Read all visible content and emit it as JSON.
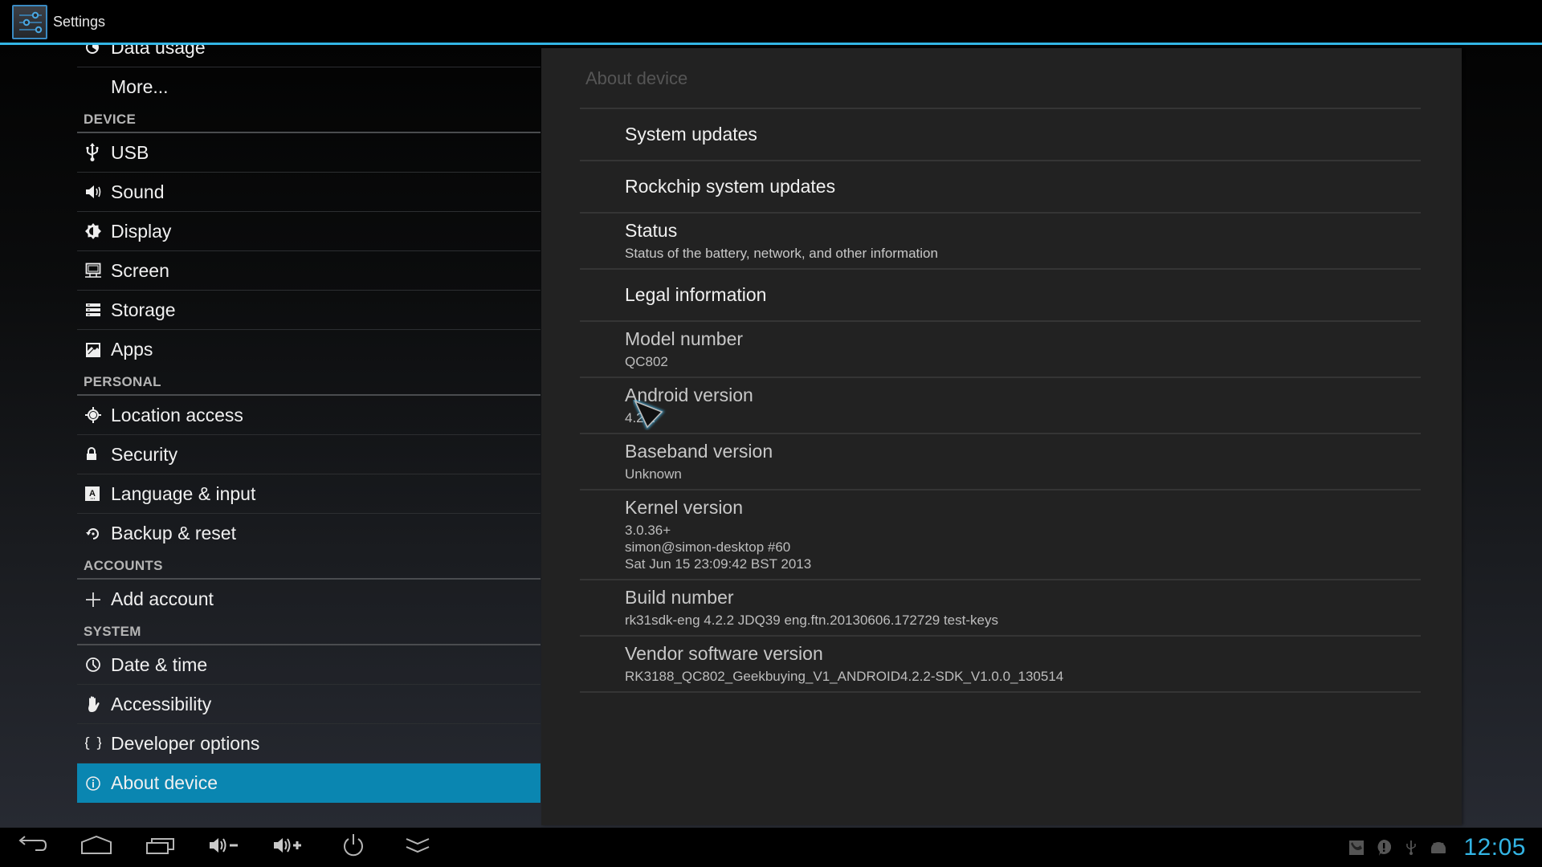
{
  "app": {
    "title": "Settings",
    "icon": "settings-sliders-icon",
    "accent_color": "#33b5e5",
    "selected_color": "#0a86b1"
  },
  "sidebar": {
    "groups": [
      {
        "header": null,
        "items": [
          {
            "label": "Data usage",
            "icon": "data-usage-icon"
          },
          {
            "label": "More...",
            "icon": null
          }
        ]
      },
      {
        "header": "DEVICE",
        "items": [
          {
            "label": "USB",
            "icon": "usb-icon"
          },
          {
            "label": "Sound",
            "icon": "sound-icon"
          },
          {
            "label": "Display",
            "icon": "display-brightness-icon"
          },
          {
            "label": "Screen",
            "icon": "screen-monitor-icon"
          },
          {
            "label": "Storage",
            "icon": "storage-icon"
          },
          {
            "label": "Apps",
            "icon": "apps-icon"
          }
        ]
      },
      {
        "header": "PERSONAL",
        "items": [
          {
            "label": "Location access",
            "icon": "location-icon"
          },
          {
            "label": "Security",
            "icon": "lock-icon"
          },
          {
            "label": "Language & input",
            "icon": "language-keyboard-icon"
          },
          {
            "label": "Backup & reset",
            "icon": "backup-reset-icon"
          }
        ]
      },
      {
        "header": "ACCOUNTS",
        "items": [
          {
            "label": "Add account",
            "icon": "plus-icon"
          }
        ]
      },
      {
        "header": "SYSTEM",
        "items": [
          {
            "label": "Date & time",
            "icon": "clock-icon"
          },
          {
            "label": "Accessibility",
            "icon": "hand-icon"
          },
          {
            "label": "Developer options",
            "icon": "braces-icon"
          },
          {
            "label": "About device",
            "icon": "info-icon",
            "selected": true
          }
        ]
      }
    ]
  },
  "panel": {
    "title": "About device",
    "items": [
      {
        "title": "System updates",
        "summary": null,
        "type": "action"
      },
      {
        "title": "Rockchip system updates",
        "summary": null,
        "type": "action"
      },
      {
        "title": "Status",
        "summary": "Status of the battery, network, and other information",
        "type": "action"
      },
      {
        "title": "Legal information",
        "summary": null,
        "type": "action"
      },
      {
        "title": "Model number",
        "summary": "QC802",
        "type": "info"
      },
      {
        "title": "Android version",
        "summary": "4.2.2",
        "type": "info"
      },
      {
        "title": "Baseband version",
        "summary": "Unknown",
        "type": "info"
      },
      {
        "title": "Kernel version",
        "summary_lines": [
          "3.0.36+",
          "simon@simon-desktop #60",
          "Sat Jun 15 23:09:42 BST 2013"
        ],
        "type": "info"
      },
      {
        "title": "Build number",
        "summary": "rk31sdk-eng 4.2.2 JDQ39 eng.ftn.20130606.172729 test-keys",
        "type": "info"
      },
      {
        "title": "Vendor software version",
        "summary": "RK3188_QC802_Geekbuying_V1_ANDROID4.2.2-SDK_V1.0.0_130514",
        "type": "info"
      }
    ]
  },
  "navbar": {
    "buttons": [
      {
        "name": "back",
        "icon": "back-icon"
      },
      {
        "name": "home",
        "icon": "home-icon"
      },
      {
        "name": "recents",
        "icon": "recent-apps-icon"
      },
      {
        "name": "volume-down",
        "icon": "volume-down-icon"
      },
      {
        "name": "volume-up",
        "icon": "volume-up-icon"
      },
      {
        "name": "power",
        "icon": "power-icon"
      },
      {
        "name": "expand",
        "icon": "chevron-double-down-icon"
      }
    ],
    "status_icons": [
      "screenshot-icon",
      "alert-icon",
      "usb-icon",
      "android-debug-icon"
    ],
    "clock": "12:05"
  }
}
